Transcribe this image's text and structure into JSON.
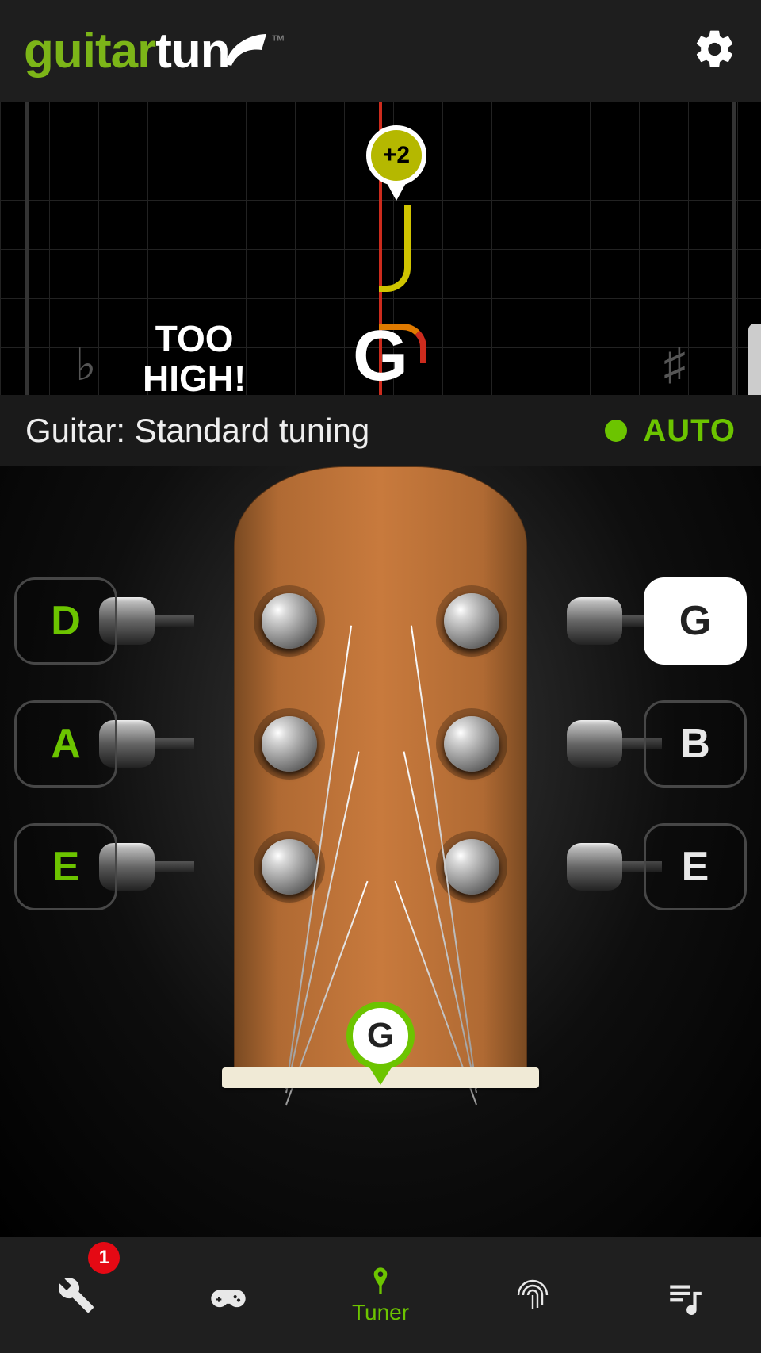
{
  "logo": {
    "part1": "guitar",
    "part2": "tun"
  },
  "tuner": {
    "cents": "+2",
    "status": "TOO\nHIGH!",
    "note": "G",
    "flat": "♭",
    "sharp": "♯"
  },
  "tuning": {
    "label": "Guitar: Standard tuning",
    "auto": "AUTO"
  },
  "strings": {
    "left": [
      "D",
      "A",
      "E"
    ],
    "right": [
      "G",
      "B",
      "E"
    ],
    "active": "G",
    "marker": "G"
  },
  "nav": {
    "tools_badge": "1",
    "tuner_label": "Tuner"
  }
}
